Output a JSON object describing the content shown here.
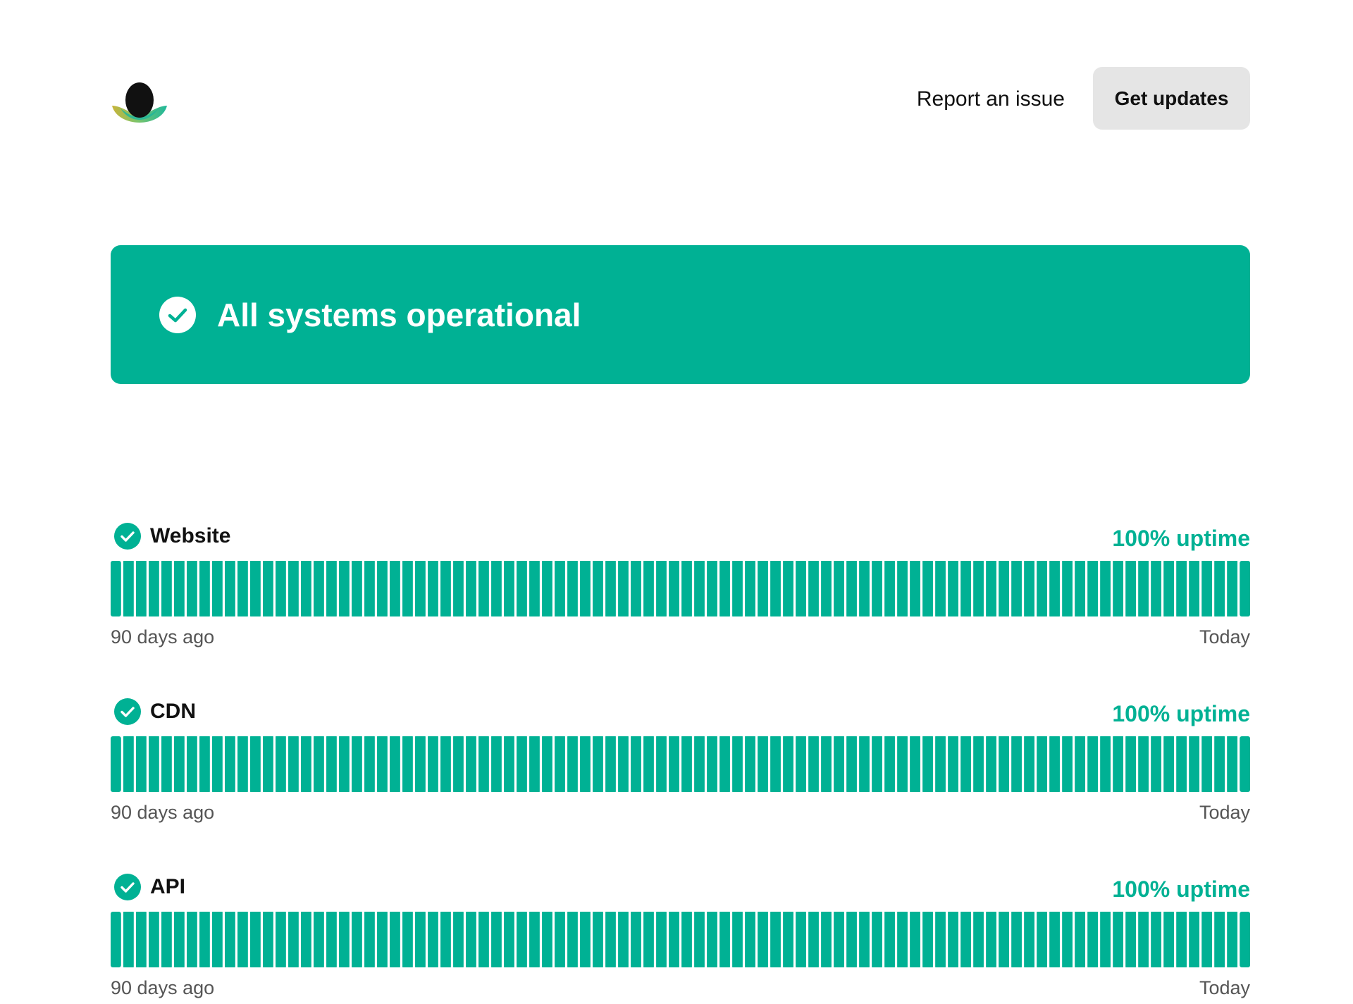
{
  "header": {
    "report_label": "Report an issue",
    "updates_label": "Get updates"
  },
  "banner": {
    "status_text": "All systems operational"
  },
  "colors": {
    "operational": "#00b194",
    "button_bg": "#e5e5e5",
    "muted_text": "#555555"
  },
  "components": [
    {
      "name": "Website",
      "uptime_label": "100% uptime",
      "start_label": "90 days ago",
      "end_label": "Today",
      "status": "operational",
      "days": 90,
      "uptime_percent": 100
    },
    {
      "name": "CDN",
      "uptime_label": "100% uptime",
      "start_label": "90 days ago",
      "end_label": "Today",
      "status": "operational",
      "days": 90,
      "uptime_percent": 100
    },
    {
      "name": "API",
      "uptime_label": "100% uptime",
      "start_label": "90 days ago",
      "end_label": "Today",
      "status": "operational",
      "days": 90,
      "uptime_percent": 100
    }
  ]
}
